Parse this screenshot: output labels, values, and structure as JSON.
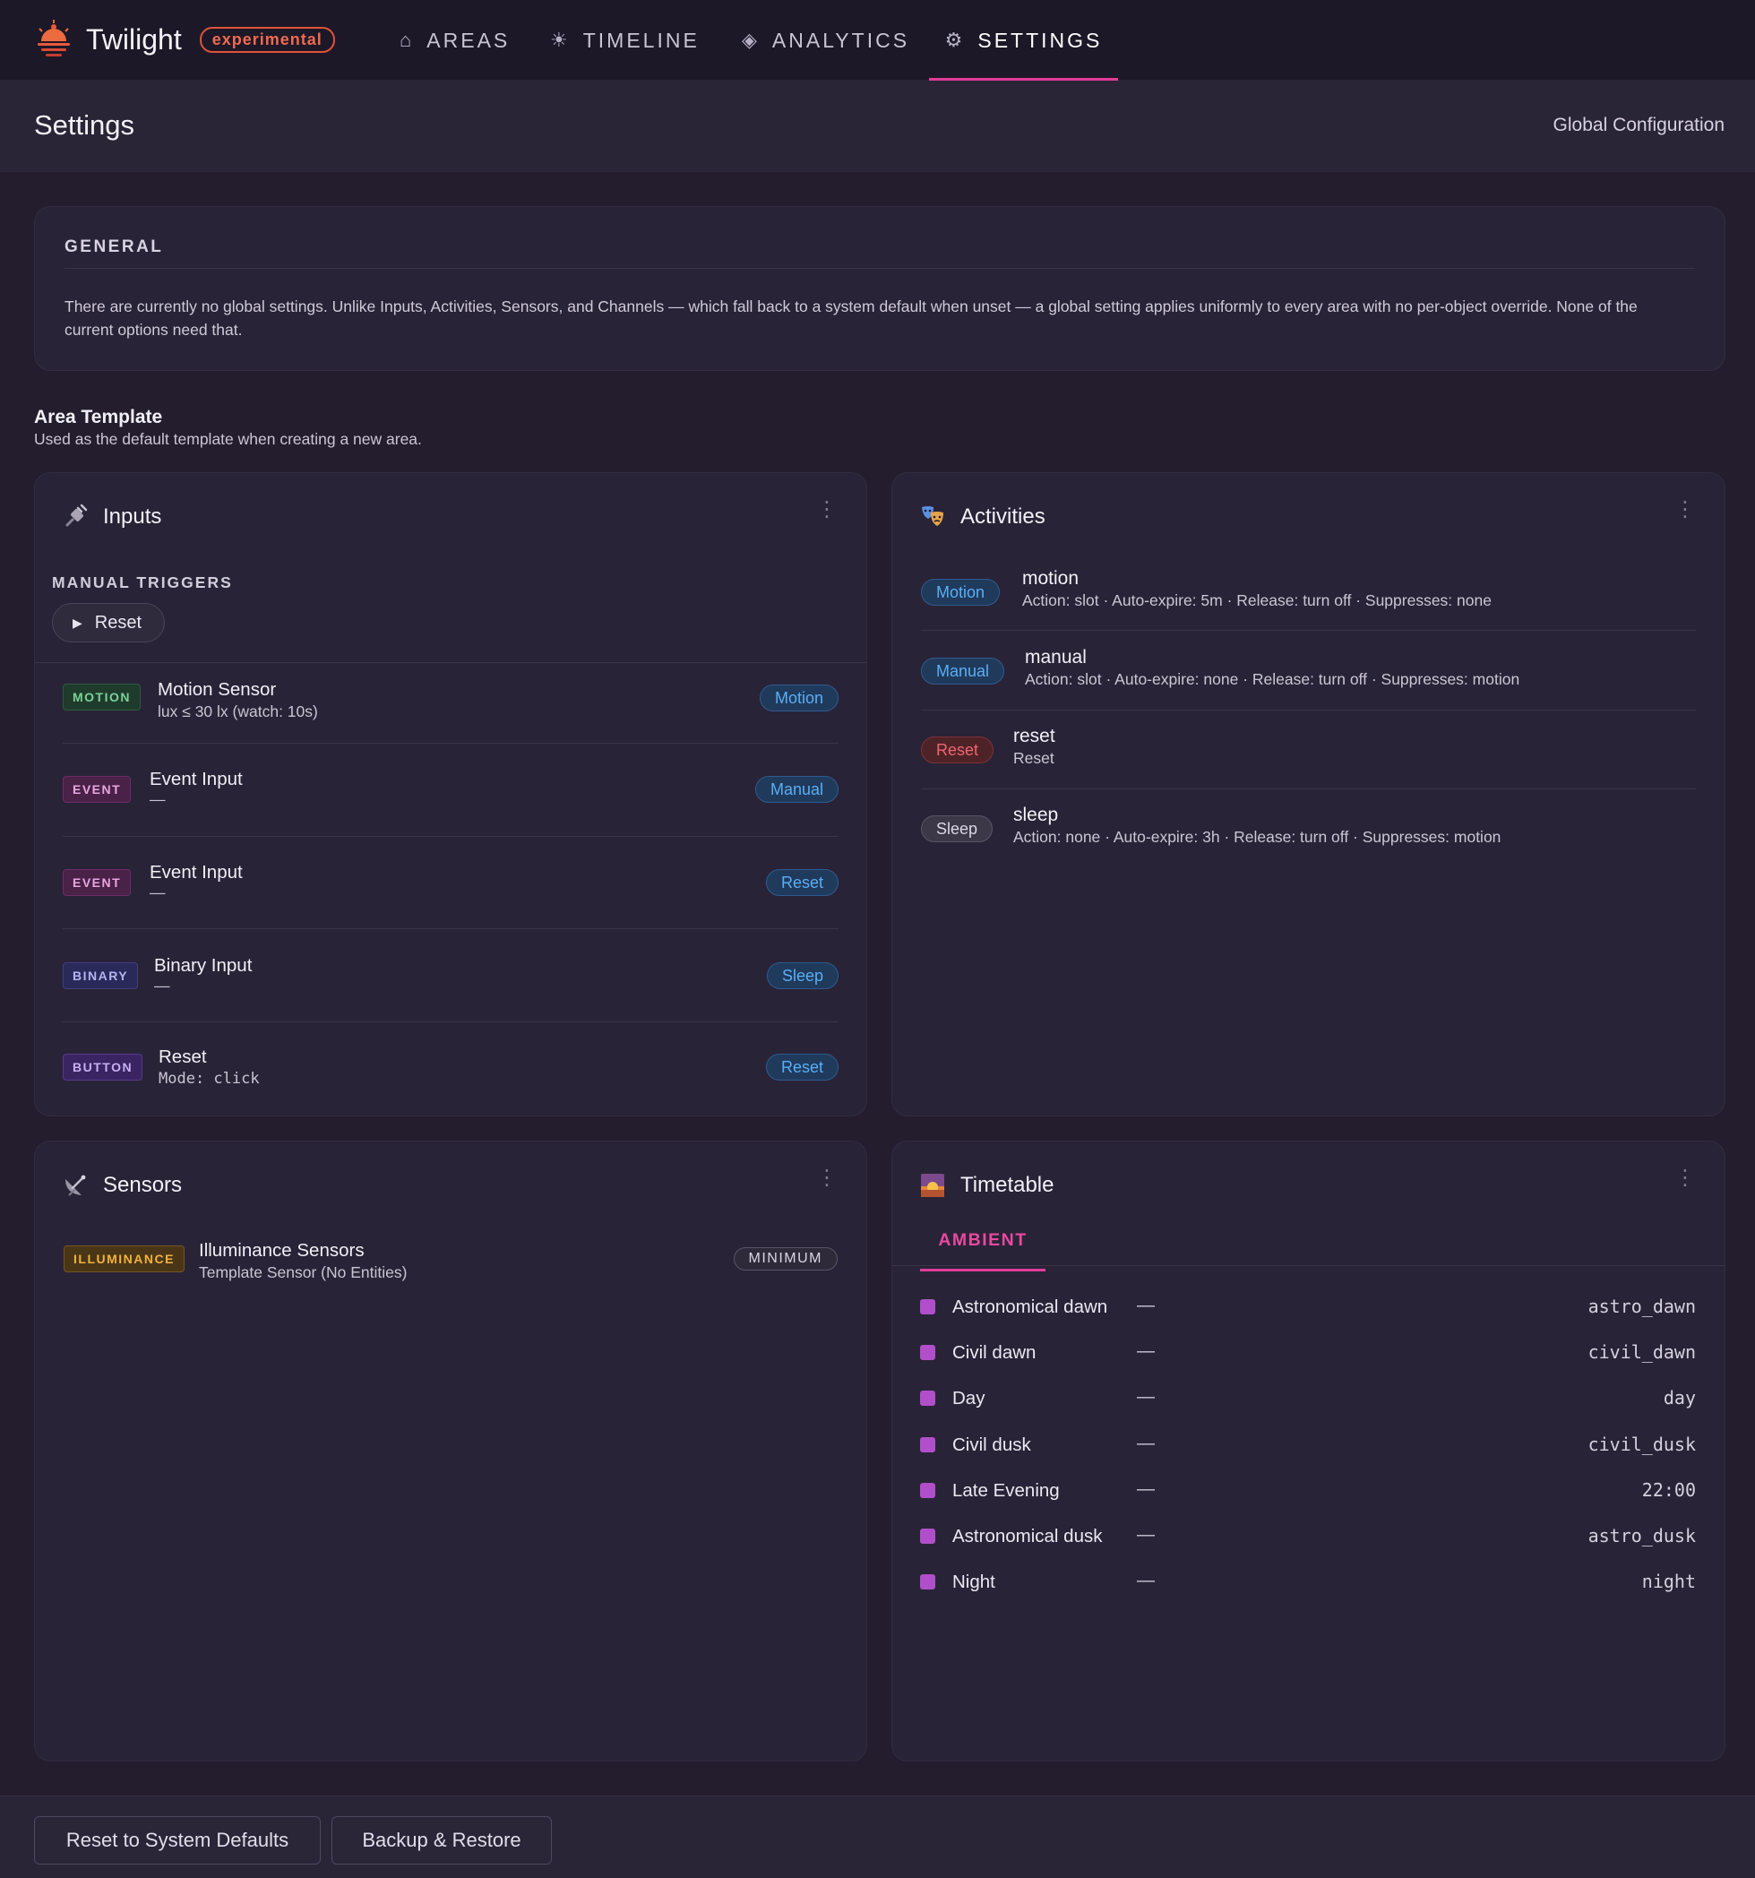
{
  "app": {
    "name": "Twilight",
    "badge": "experimental"
  },
  "nav": {
    "tabs": [
      {
        "label": "AREAS",
        "icon": "home-icon"
      },
      {
        "label": "TIMELINE",
        "icon": "sun-icon"
      },
      {
        "label": "ANALYTICS",
        "icon": "diamond-icon"
      },
      {
        "label": "SETTINGS",
        "icon": "gear-icon",
        "active": true
      }
    ]
  },
  "header": {
    "title": "Settings",
    "subtitle": "Global Configuration"
  },
  "general": {
    "title": "GENERAL",
    "text": "There are currently no global settings. Unlike Inputs, Activities, Sensors, and Channels — which fall back to a system default when unset — a global setting applies uniformly to every area with no per-object override. None of the current options need that."
  },
  "area_template": {
    "title": "Area Template",
    "subtitle": "Used as the default template when creating a new area."
  },
  "inputs": {
    "title": "Inputs",
    "icon": "plug-icon",
    "manual_triggers_label": "MANUAL TRIGGERS",
    "reset_button": "Reset",
    "rows": [
      {
        "type": "MOTION",
        "name": "Motion Sensor",
        "desc": "lux ≤ 30 lx (watch: 10s)",
        "pill": "Motion"
      },
      {
        "type": "EVENT",
        "name": "Event Input",
        "desc": "—",
        "pill": "Manual"
      },
      {
        "type": "EVENT",
        "name": "Event Input",
        "desc": "—",
        "pill": "Reset"
      },
      {
        "type": "BINARY",
        "name": "Binary Input",
        "desc": "—",
        "pill": "Sleep"
      },
      {
        "type": "BUTTON",
        "name": "Reset",
        "desc": "Mode: click",
        "pill": "Reset"
      }
    ]
  },
  "activities": {
    "title": "Activities",
    "icon": "masks-icon",
    "rows": [
      {
        "pill": "Motion",
        "name": "motion",
        "desc": "Action: slot · Auto-expire: 5m · Release: turn off · Suppresses: none"
      },
      {
        "pill": "Manual",
        "name": "manual",
        "desc": "Action: slot · Auto-expire: none · Release: turn off · Suppresses: motion"
      },
      {
        "pill": "Reset",
        "name": "reset",
        "desc": "Reset"
      },
      {
        "pill": "Sleep",
        "name": "sleep",
        "desc": "Action: none · Auto-expire: 3h · Release: turn off · Suppresses: motion"
      }
    ]
  },
  "sensors": {
    "title": "Sensors",
    "icon": "satellite-dish-icon",
    "rows": [
      {
        "type": "ILLUMINANCE",
        "name": "Illuminance Sensors",
        "desc": "Template Sensor (No Entities)",
        "pill": "MINIMUM"
      }
    ]
  },
  "timetable": {
    "title": "Timetable",
    "icon": "sunrise-icon",
    "tab": "AMBIENT",
    "rows": [
      {
        "name": "Astronomical dawn",
        "dash": "—",
        "value": "astro_dawn"
      },
      {
        "name": "Civil dawn",
        "dash": "—",
        "value": "civil_dawn"
      },
      {
        "name": "Day",
        "dash": "—",
        "value": "day"
      },
      {
        "name": "Civil dusk",
        "dash": "—",
        "value": "civil_dusk"
      },
      {
        "name": "Late Evening",
        "dash": "—",
        "value": "22:00"
      },
      {
        "name": "Astronomical dusk",
        "dash": "—",
        "value": "astro_dusk"
      },
      {
        "name": "Night",
        "dash": "—",
        "value": "night"
      }
    ]
  },
  "footer": {
    "reset_defaults": "Reset to System Defaults",
    "backup_restore": "Backup & Restore"
  },
  "colors": {
    "accent": "#e23d9a",
    "background": "#231d2e",
    "card": "#292337"
  }
}
